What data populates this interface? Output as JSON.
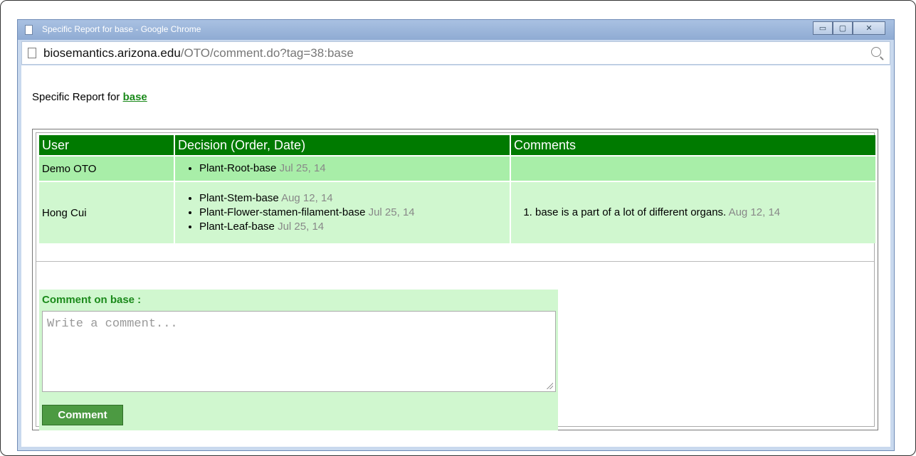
{
  "window": {
    "title": "Specific Report for base - Google Chrome",
    "controls": {
      "minimize": "▭",
      "maximize": "▢",
      "close": "✕"
    }
  },
  "urlbar": {
    "host": "biosemantics.arizona.edu",
    "path": "/OTO/comment.do?tag=38:base"
  },
  "page": {
    "heading_prefix": "Specific Report for ",
    "heading_term": "base"
  },
  "table": {
    "headers": [
      "User",
      "Decision (Order, Date)",
      "Comments"
    ],
    "rows": [
      {
        "user": "Demo OTO",
        "decisions": [
          {
            "term": "Plant-Root-base",
            "date": "Jul 25, 14"
          }
        ],
        "comments": []
      },
      {
        "user": "Hong Cui",
        "decisions": [
          {
            "term": "Plant-Stem-base",
            "date": "Aug 12, 14"
          },
          {
            "term": "Plant-Flower-stamen-filament-base",
            "date": "Jul 25, 14"
          },
          {
            "term": "Plant-Leaf-base",
            "date": "Jul 25, 14"
          }
        ],
        "comments": [
          {
            "text": "base is a part of a lot of different organs.",
            "date": "Aug 12, 14"
          }
        ]
      }
    ]
  },
  "comment_form": {
    "label": "Comment on base :",
    "placeholder": "Write a comment...",
    "button": "Comment"
  },
  "colors": {
    "header_green": "#007a00",
    "row_light": "#a8eea8",
    "row_lighter": "#d0f7cf",
    "link_green": "#1b8a1b",
    "button_green": "#4c9a42"
  },
  "icons": {
    "page": "page-icon",
    "zoom": "zoom-icon"
  }
}
